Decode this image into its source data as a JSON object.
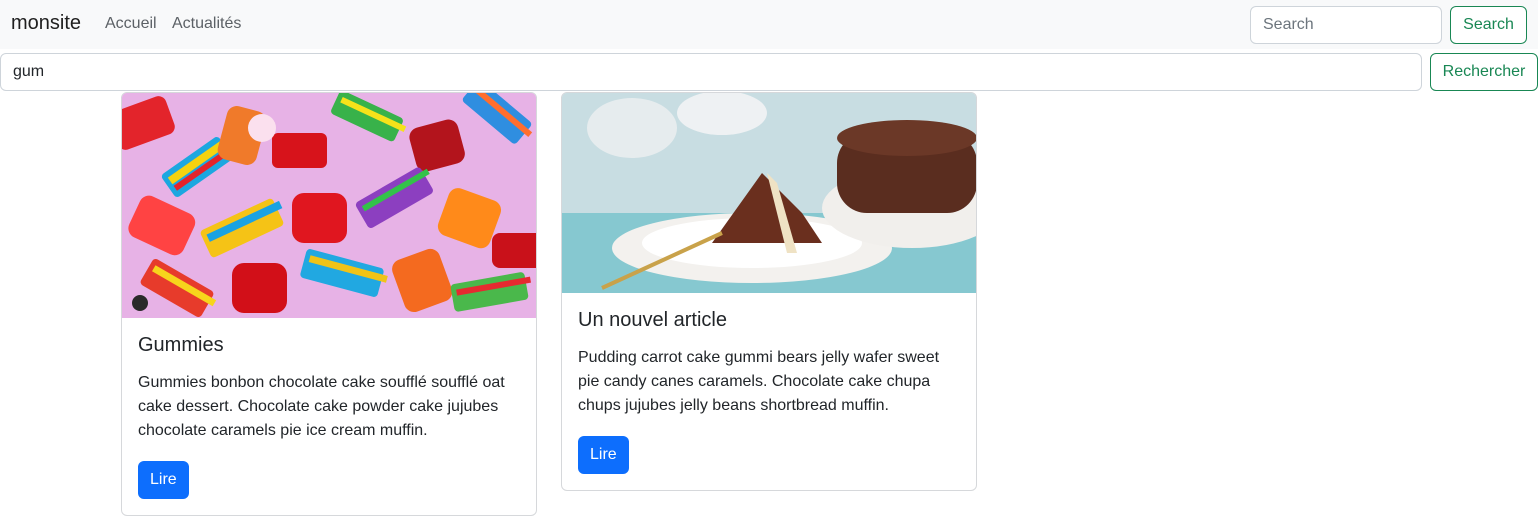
{
  "navbar": {
    "brand": "monsite",
    "links": [
      "Accueil",
      "Actualités"
    ],
    "search_placeholder": "Search",
    "search_button": "Search"
  },
  "query": {
    "value": "gum",
    "button": "Rechercher"
  },
  "colors": {
    "primary": "#0d6efd",
    "success": "#198754",
    "navbar_bg": "#f8f9fa"
  },
  "articles": [
    {
      "title": "Gummies",
      "text": "Gummies bonbon chocolate cake soufflé soufflé oat cake dessert. Chocolate cake powder cake jujubes chocolate caramels pie ice cream muffin.",
      "button": "Lire",
      "image": "gummy-candies-photo"
    },
    {
      "title": "Un nouvel article",
      "text": "Pudding carrot cake gummi bears jelly wafer sweet pie candy canes caramels. Chocolate cake chupa chups jujubes jelly beans shortbread muffin.",
      "button": "Lire",
      "image": "pudding-cake-with-custard-photo"
    }
  ]
}
